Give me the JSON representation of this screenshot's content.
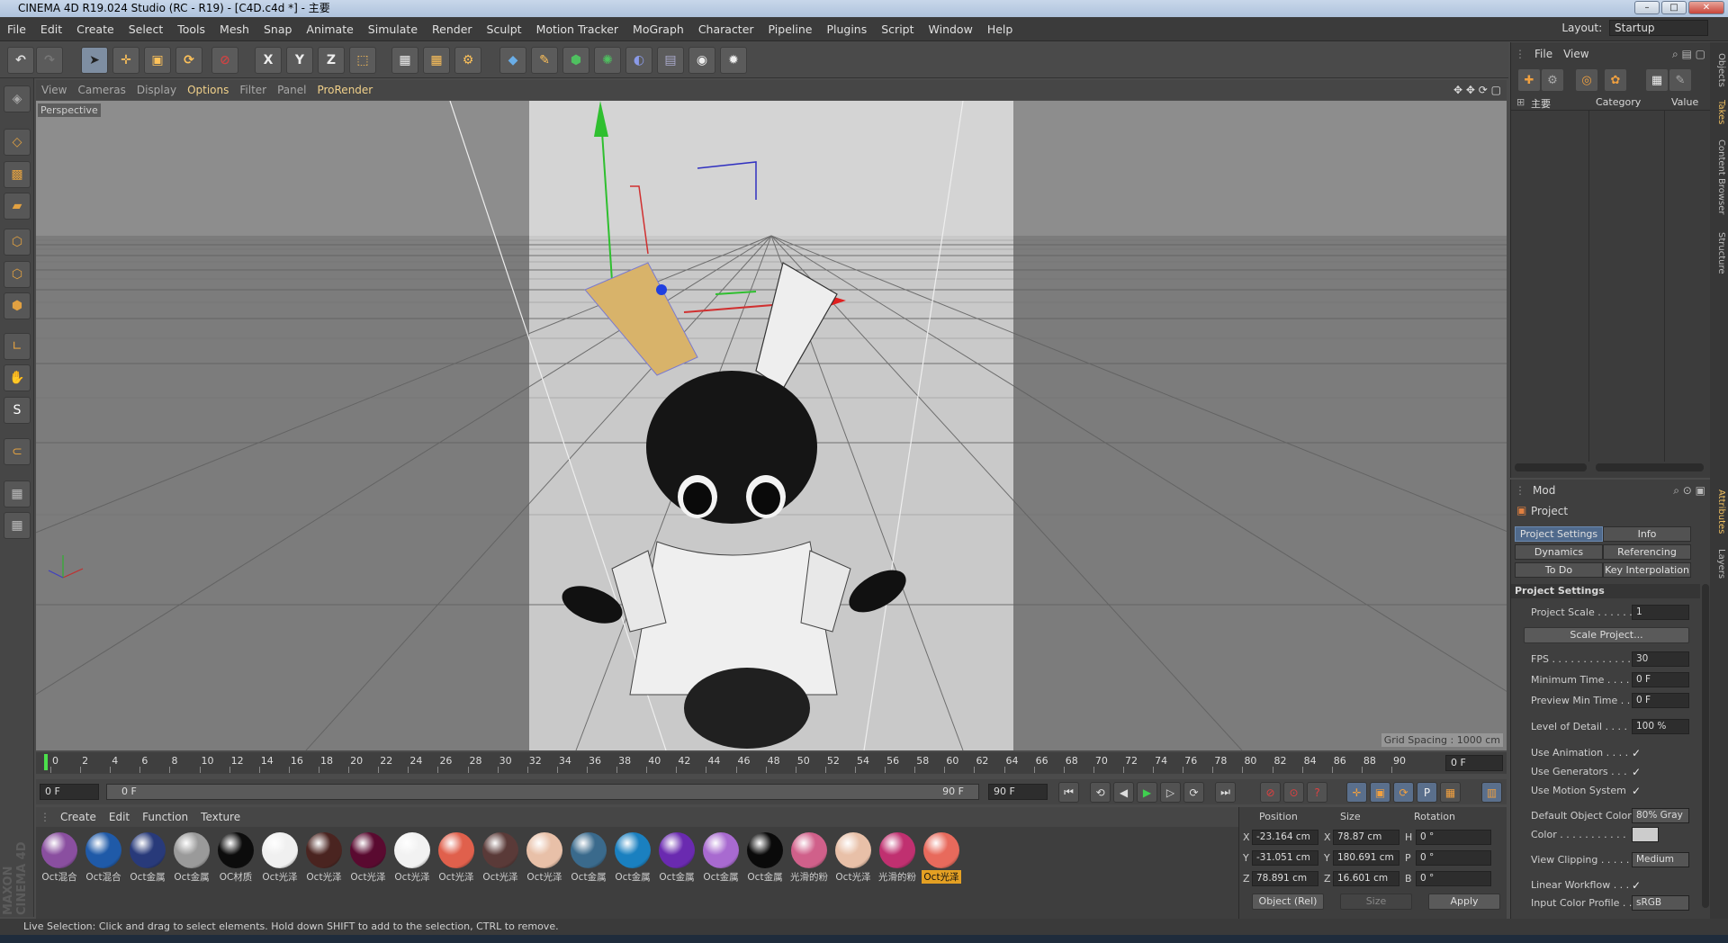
{
  "window": {
    "title": "CINEMA 4D R19.024 Studio (RC - R19) - [C4D.c4d *] - 主要"
  },
  "menu": [
    "File",
    "Edit",
    "Create",
    "Select",
    "Tools",
    "Mesh",
    "Snap",
    "Animate",
    "Simulate",
    "Sculpt",
    "Render",
    "Sculpt",
    "Motion Tracker",
    "MoGraph",
    "Character",
    "Pipeline",
    "Plugins",
    "Script",
    "Window",
    "Help"
  ],
  "layout": {
    "label": "Layout:",
    "value": "Startup"
  },
  "viewport": {
    "menu": [
      "View",
      "Cameras",
      "Display",
      "Options",
      "Filter",
      "Panel",
      "ProRender"
    ],
    "label": "Perspective",
    "grid_spacing": "Grid Spacing : 1000 cm"
  },
  "timeline": {
    "ticks": [
      "0",
      "2",
      "4",
      "6",
      "8",
      "10",
      "12",
      "14",
      "16",
      "18",
      "20",
      "22",
      "24",
      "26",
      "28",
      "30",
      "32",
      "34",
      "36",
      "38",
      "40",
      "42",
      "44",
      "46",
      "48",
      "50",
      "52",
      "54",
      "56",
      "58",
      "60",
      "62",
      "64",
      "66",
      "68",
      "70",
      "72",
      "74",
      "76",
      "78",
      "80",
      "82",
      "84",
      "86",
      "88",
      "90"
    ],
    "current_frame": "0 F",
    "start": "0 F",
    "range_start": "0 F",
    "range_end": "90 F",
    "end": "90 F"
  },
  "material_menu": [
    "Create",
    "Edit",
    "Function",
    "Texture"
  ],
  "materials": [
    {
      "label": "Oct混合",
      "color": "#8a4fa0"
    },
    {
      "label": "Oct混合",
      "color": "#1f5aa8"
    },
    {
      "label": "Oct金属",
      "color": "#283a7a"
    },
    {
      "label": "Oct金属",
      "color": "#9a9a9a"
    },
    {
      "label": "OC材质",
      "color": "#0c0c0c"
    },
    {
      "label": "Oct光泽",
      "color": "#f0f0f0"
    },
    {
      "label": "Oct光泽",
      "color": "#4a2420"
    },
    {
      "label": "Oct光泽",
      "color": "#5a0a30"
    },
    {
      "label": "Oct光泽",
      "color": "#f2f2f2"
    },
    {
      "label": "Oct光泽",
      "color": "#e0604c"
    },
    {
      "label": "Oct光泽",
      "color": "#5a3a38"
    },
    {
      "label": "Oct光泽",
      "color": "#e8c0a8"
    },
    {
      "label": "Oct金属",
      "color": "#3a6a8c"
    },
    {
      "label": "Oct金属",
      "color": "#1a80c0"
    },
    {
      "label": "Oct金属",
      "color": "#6a2ab0"
    },
    {
      "label": "Oct金属",
      "color": "#a86ad0"
    },
    {
      "label": "Oct金属",
      "color": "#0a0a0a"
    },
    {
      "label": "光滑的粉",
      "color": "#d0608a"
    },
    {
      "label": "Oct光泽",
      "color": "#e8c0a8"
    },
    {
      "label": "光滑的粉",
      "color": "#c03070"
    },
    {
      "label": "Oct光泽",
      "color": "#e86a5c"
    }
  ],
  "coords": {
    "headers": [
      "Position",
      "Size",
      "Rotation"
    ],
    "rows": [
      {
        "axis": "X",
        "pos": "-23.164 cm",
        "saxis": "X",
        "size": "78.87 cm",
        "raxis": "H",
        "rot": "0 °"
      },
      {
        "axis": "Y",
        "pos": "-31.051 cm",
        "saxis": "Y",
        "size": "180.691 cm",
        "raxis": "P",
        "rot": "0 °"
      },
      {
        "axis": "Z",
        "pos": "78.891 cm",
        "saxis": "Z",
        "size": "16.601 cm",
        "raxis": "B",
        "rot": "0 °"
      }
    ],
    "mode": "Object (Rel)",
    "size_mode": "Size",
    "apply": "Apply"
  },
  "status": "Live Selection: Click and drag to select elements. Hold down SHIFT to add to the selection, CTRL to remove.",
  "objects": {
    "menu": [
      "File",
      "View"
    ],
    "columns": [
      "主要",
      "Category",
      "Value"
    ]
  },
  "attributes": {
    "menu": "Mod",
    "title": "Project",
    "tabs": [
      "Project Settings",
      "Info",
      "Dynamics",
      "Referencing",
      "To Do",
      "Key Interpolation"
    ],
    "section": "Project Settings",
    "rows": [
      {
        "label": "Project Scale . . . . . .",
        "value": "1"
      },
      {
        "label": "FPS . . . . . . . . . . . . . .",
        "value": "30"
      },
      {
        "label": "Minimum Time . . . .",
        "value": "0 F"
      },
      {
        "label": "Preview Min Time . .",
        "value": "0 F"
      },
      {
        "label": "Level of Detail . . . .",
        "value": "100 %"
      },
      {
        "label": "Use Animation . . . .",
        "value": "✓"
      },
      {
        "label": "Use Generators . . .",
        "value": "✓"
      },
      {
        "label": "Use Motion System",
        "value": "✓"
      },
      {
        "label": "Default Object Color",
        "value": "80% Gray"
      },
      {
        "label": "Color . . . . . . . . . . .",
        "value": ""
      },
      {
        "label": "View Clipping . . . . .",
        "value": "Medium"
      },
      {
        "label": "Linear Workflow . . .",
        "value": "✓"
      },
      {
        "label": "Input Color Profile . .",
        "value": "sRGB"
      }
    ],
    "scale_button": "Scale Project..."
  },
  "side_tabs": [
    "Objects",
    "Takes",
    "Content Browser",
    "Structure",
    "Attributes",
    "Layers"
  ],
  "brand": [
    "MAXON",
    "CINEMA 4D"
  ]
}
